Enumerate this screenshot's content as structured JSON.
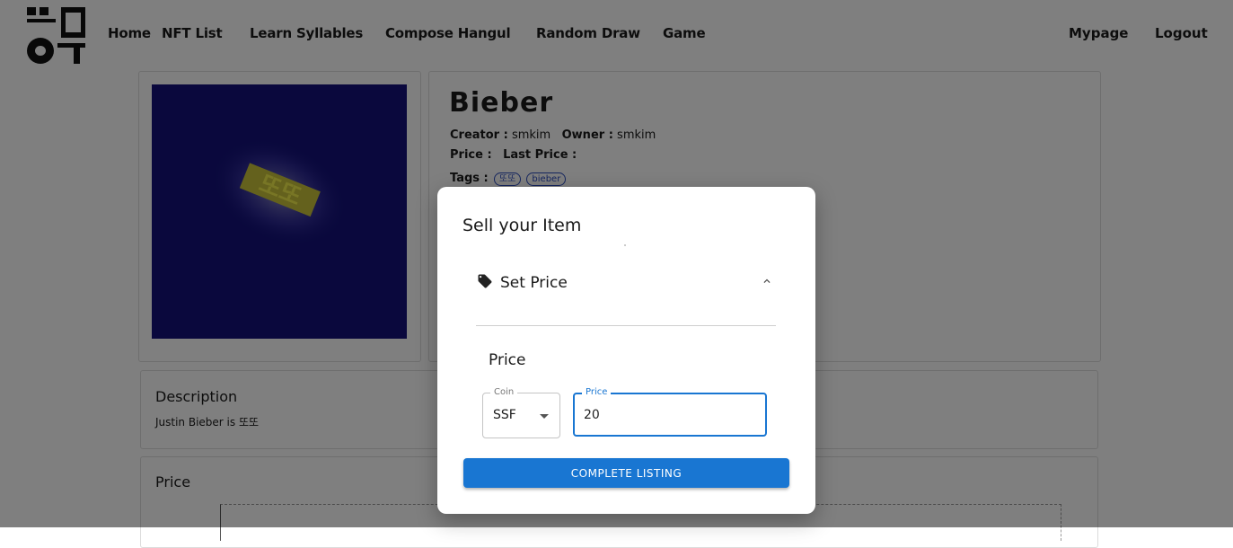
{
  "nav": {
    "items": [
      "Home",
      "NFT List",
      "Learn Syllables",
      "Compose Hangul",
      "Random Draw",
      "Game"
    ],
    "right": [
      "Mypage",
      "Logout"
    ]
  },
  "nft": {
    "name": "Bieber",
    "creator_label": "Creator :",
    "creator": "smkim",
    "owner_label": "Owner :",
    "owner": "smkim",
    "price_label": "Price :",
    "last_price_label": "Last Price :",
    "tags_label": "Tags :",
    "tags": [
      "또또",
      "bieber"
    ],
    "image_text": "또또"
  },
  "description": {
    "title": "Description",
    "text": "Justin Bieber is 또또"
  },
  "price_section": {
    "title": "Price"
  },
  "modal": {
    "title": "Sell your Item",
    "accordion_label": "Set Price",
    "price_label": "Price",
    "coin_legend": "Coin",
    "coin_value": "SSF",
    "price_legend": "Price",
    "price_value": "20",
    "button_label": "COMPLETE LISTING"
  },
  "colors": {
    "accent": "#1976d2",
    "image_bg": "#14117a",
    "image_text": "#e8e23a"
  }
}
